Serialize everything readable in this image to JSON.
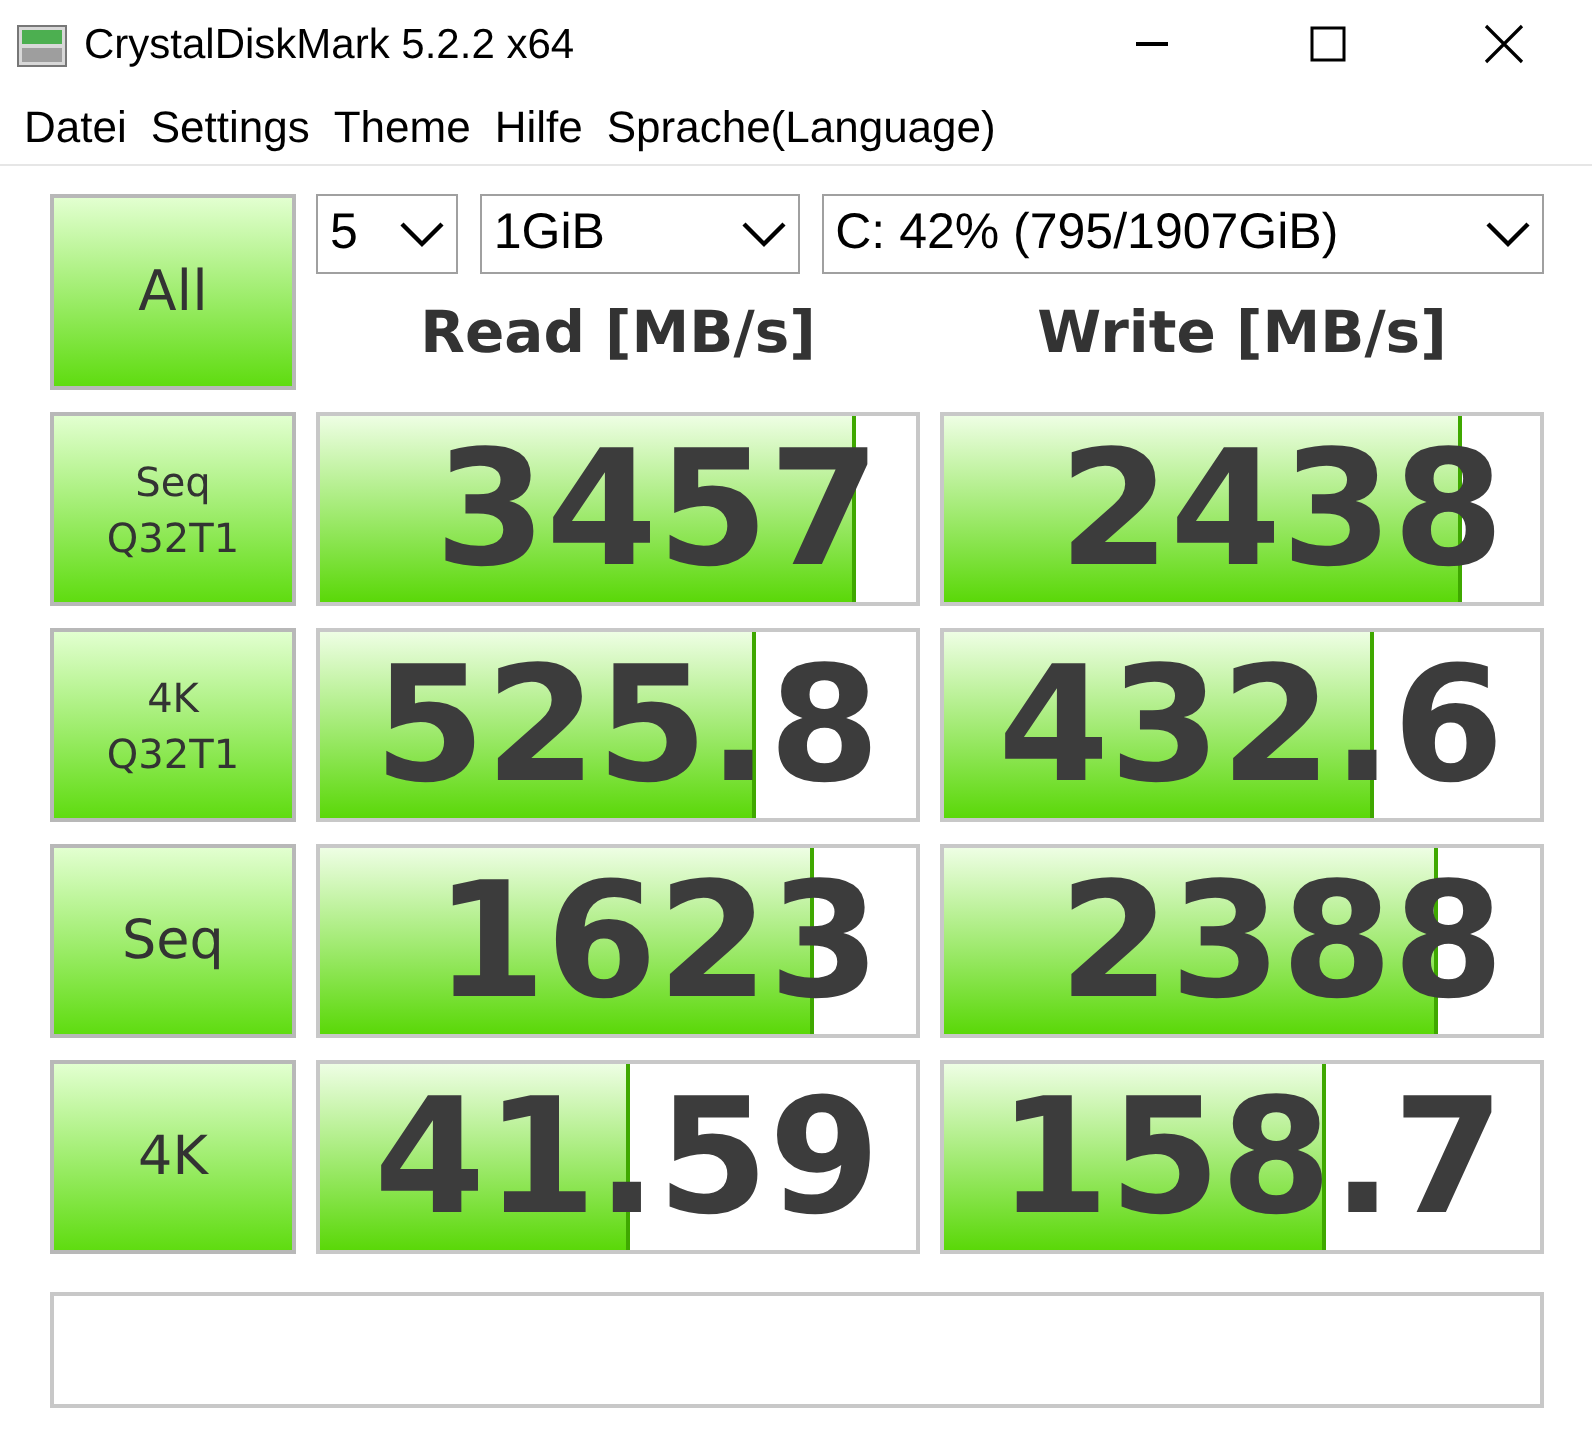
{
  "window": {
    "title": "CrystalDiskMark 5.2.2 x64"
  },
  "menu": [
    "Datei",
    "Settings",
    "Theme",
    "Hilfe",
    "Sprache(Language)"
  ],
  "settings": {
    "all_button": "All",
    "count": "5",
    "size": "1GiB",
    "drive": "C: 42% (795/1907GiB)"
  },
  "columns": [
    "Read [MB/s]",
    "Write [MB/s]"
  ],
  "tests": [
    {
      "label": [
        "Seq",
        "Q32T1"
      ],
      "read": {
        "value": "3457",
        "level": 0.9
      },
      "write": {
        "value": "2438",
        "level": 0.87
      }
    },
    {
      "label": [
        "4K",
        "Q32T1"
      ],
      "read": {
        "value": "525.8",
        "level": 0.73
      },
      "write": {
        "value": "432.6",
        "level": 0.72
      }
    },
    {
      "label": [
        "Seq"
      ],
      "read": {
        "value": "1623",
        "level": 0.83
      },
      "write": {
        "value": "2388",
        "level": 0.83
      }
    },
    {
      "label": [
        "4K"
      ],
      "read": {
        "value": "41.59",
        "level": 0.52
      },
      "write": {
        "value": "158.7",
        "level": 0.64
      }
    }
  ]
}
